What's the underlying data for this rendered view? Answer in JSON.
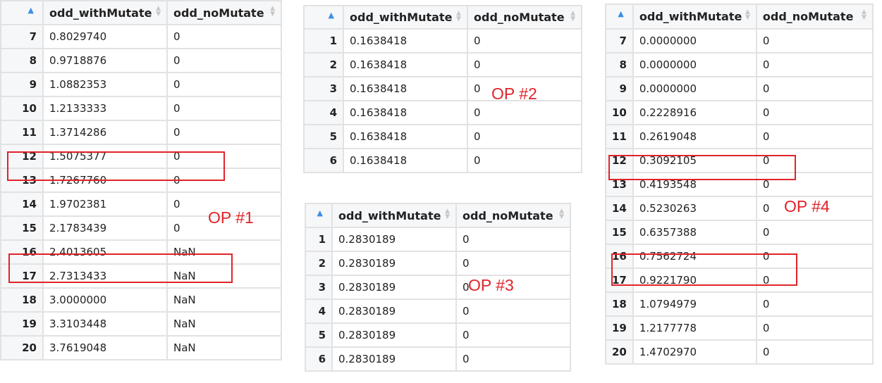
{
  "columns": [
    "odd_withMutate",
    "odd_noMutate"
  ],
  "tables": [
    {
      "label": "OP #1",
      "rows": [
        [
          "7",
          "0.8029740",
          "0"
        ],
        [
          "8",
          "0.9718876",
          "0"
        ],
        [
          "9",
          "1.0882353",
          "0"
        ],
        [
          "10",
          "1.2133333",
          "0"
        ],
        [
          "11",
          "1.3714286",
          "0"
        ],
        [
          "12",
          "1.5075377",
          "0"
        ],
        [
          "13",
          "1.7267760",
          "0"
        ],
        [
          "14",
          "1.9702381",
          "0"
        ],
        [
          "15",
          "2.1783439",
          "0"
        ],
        [
          "16",
          "2.4013605",
          "NaN"
        ],
        [
          "17",
          "2.7313433",
          "NaN"
        ],
        [
          "18",
          "3.0000000",
          "NaN"
        ],
        [
          "19",
          "3.3103448",
          "NaN"
        ],
        [
          "20",
          "3.7619048",
          "NaN"
        ]
      ],
      "highlighted_rows": [
        "12",
        "16"
      ]
    },
    {
      "label": "OP #2",
      "rows": [
        [
          "1",
          "0.1638418",
          "0"
        ],
        [
          "2",
          "0.1638418",
          "0"
        ],
        [
          "3",
          "0.1638418",
          "0"
        ],
        [
          "4",
          "0.1638418",
          "0"
        ],
        [
          "5",
          "0.1638418",
          "0"
        ],
        [
          "6",
          "0.1638418",
          "0"
        ]
      ],
      "highlighted_rows": []
    },
    {
      "label": "OP #3",
      "rows": [
        [
          "1",
          "0.2830189",
          "0"
        ],
        [
          "2",
          "0.2830189",
          "0"
        ],
        [
          "3",
          "0.2830189",
          "0"
        ],
        [
          "4",
          "0.2830189",
          "0"
        ],
        [
          "5",
          "0.2830189",
          "0"
        ],
        [
          "6",
          "0.2830189",
          "0"
        ]
      ],
      "highlighted_rows": []
    },
    {
      "label": "OP #4",
      "rows": [
        [
          "7",
          "0.0000000",
          "0"
        ],
        [
          "8",
          "0.0000000",
          "0"
        ],
        [
          "9",
          "0.0000000",
          "0"
        ],
        [
          "10",
          "0.2228916",
          "0"
        ],
        [
          "11",
          "0.2619048",
          "0"
        ],
        [
          "12",
          "0.3092105",
          "0"
        ],
        [
          "13",
          "0.4193548",
          "0"
        ],
        [
          "14",
          "0.5230263",
          "0"
        ],
        [
          "15",
          "0.6357388",
          "0"
        ],
        [
          "16",
          "0.7562724",
          "0"
        ],
        [
          "17",
          "0.9221790",
          "0"
        ],
        [
          "18",
          "1.0794979",
          "0"
        ],
        [
          "19",
          "1.2177778",
          "0"
        ],
        [
          "20",
          "1.4702970",
          "0"
        ]
      ],
      "highlighted_rows": [
        "12",
        "16"
      ]
    }
  ],
  "colors": {
    "annotation": "#e0242a",
    "sort_active": "#3a8ee6"
  }
}
